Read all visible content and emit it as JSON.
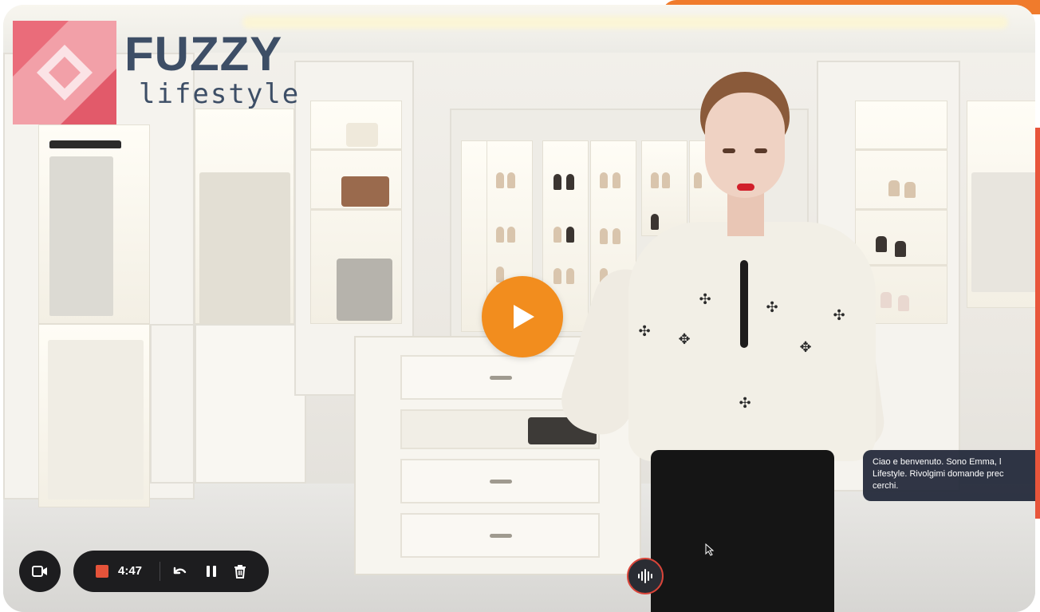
{
  "logo": {
    "brand": "FUZZY",
    "tagline": "lifestyle"
  },
  "video": {
    "play_label": "play",
    "caption_lines": [
      "Ciao e benvenuto. Sono Emma, l",
      "Lifestyle. Rivolgimi domande prec",
      "cerchi."
    ]
  },
  "recorder": {
    "elapsed": "4:47"
  },
  "icons": {
    "camera": "camera-icon",
    "stop": "stop-icon",
    "undo": "undo-icon",
    "pause": "pause-icon",
    "trash": "trash-icon",
    "mic": "audio-wave-icon",
    "play": "play-icon"
  },
  "colors": {
    "accent_orange": "#f28d1e",
    "accent_top": "#f07b2c",
    "logo_text": "#3d4e66",
    "logo_pink": "#ea6c7a",
    "record_red": "#e5533a",
    "control_bg": "#1d1d1f",
    "caption_bg": "#1e2536"
  }
}
